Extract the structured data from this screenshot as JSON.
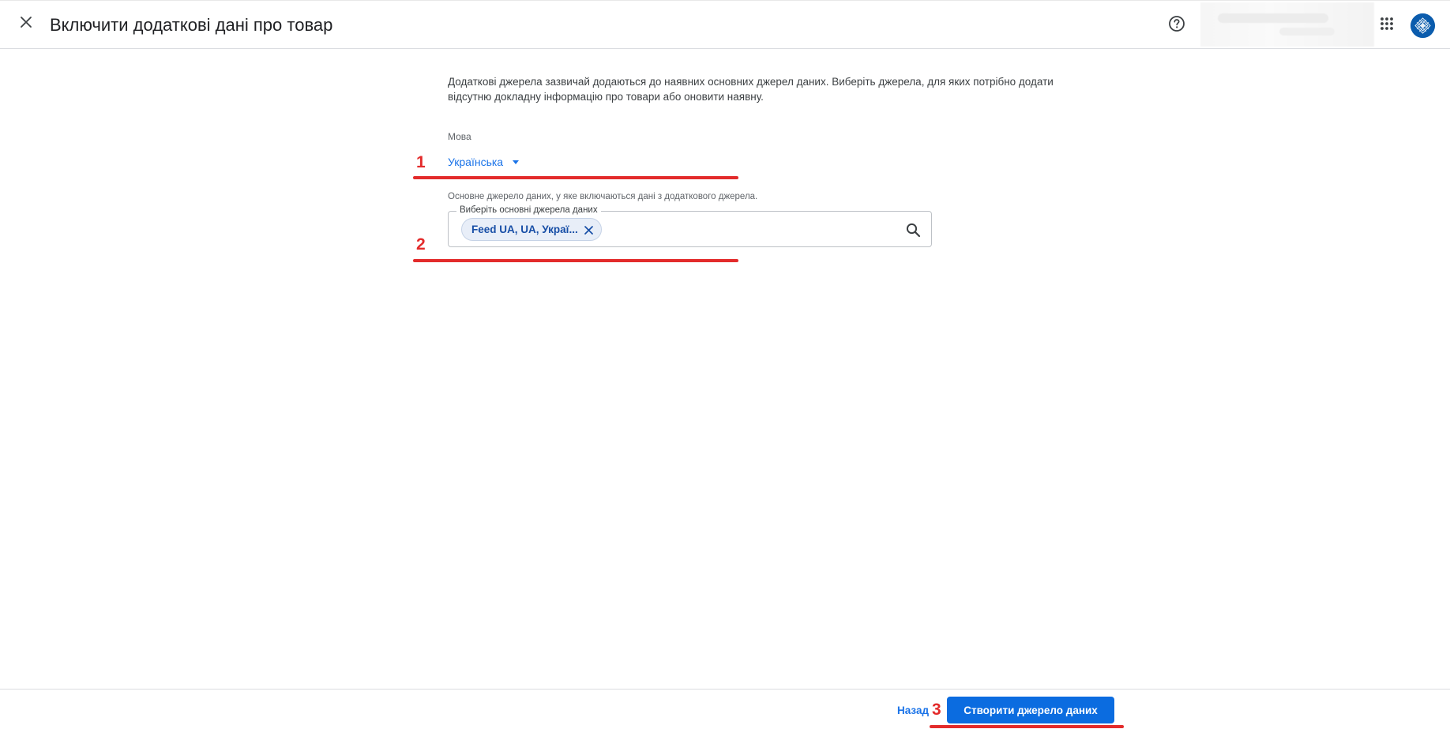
{
  "header": {
    "title": "Включити додаткові дані про товар"
  },
  "intro": {
    "text": "Додаткові джерела зазвичай додаються до наявних основних джерел даних. Виберіть джерела, для яких потрібно додати відсутню докладну інформацію про товари або оновити наявну."
  },
  "language": {
    "label": "Мова",
    "selected": "Українська"
  },
  "primary_source": {
    "helper": "Основне джерело даних, у яке включаються дані з додаткового джерела.",
    "field_label": "Виберіть основні джерела даних",
    "chips": [
      "Feed UA, UA, Украї..."
    ]
  },
  "annotations": {
    "step1": "1",
    "step2": "2",
    "step3": "3",
    "color": "#e32b2b"
  },
  "footer": {
    "back_label": "Назад",
    "create_label": "Створити джерело даних"
  },
  "colors": {
    "accent": "#1a73e8",
    "primary_button": "#0b6ce0",
    "chip_bg": "#e8eef8"
  },
  "icons": {
    "close": "close-icon",
    "help": "help-icon",
    "apps": "apps-grid-icon",
    "search": "search-icon",
    "chip_remove": "close-icon",
    "dropdown": "caret-down-icon"
  }
}
